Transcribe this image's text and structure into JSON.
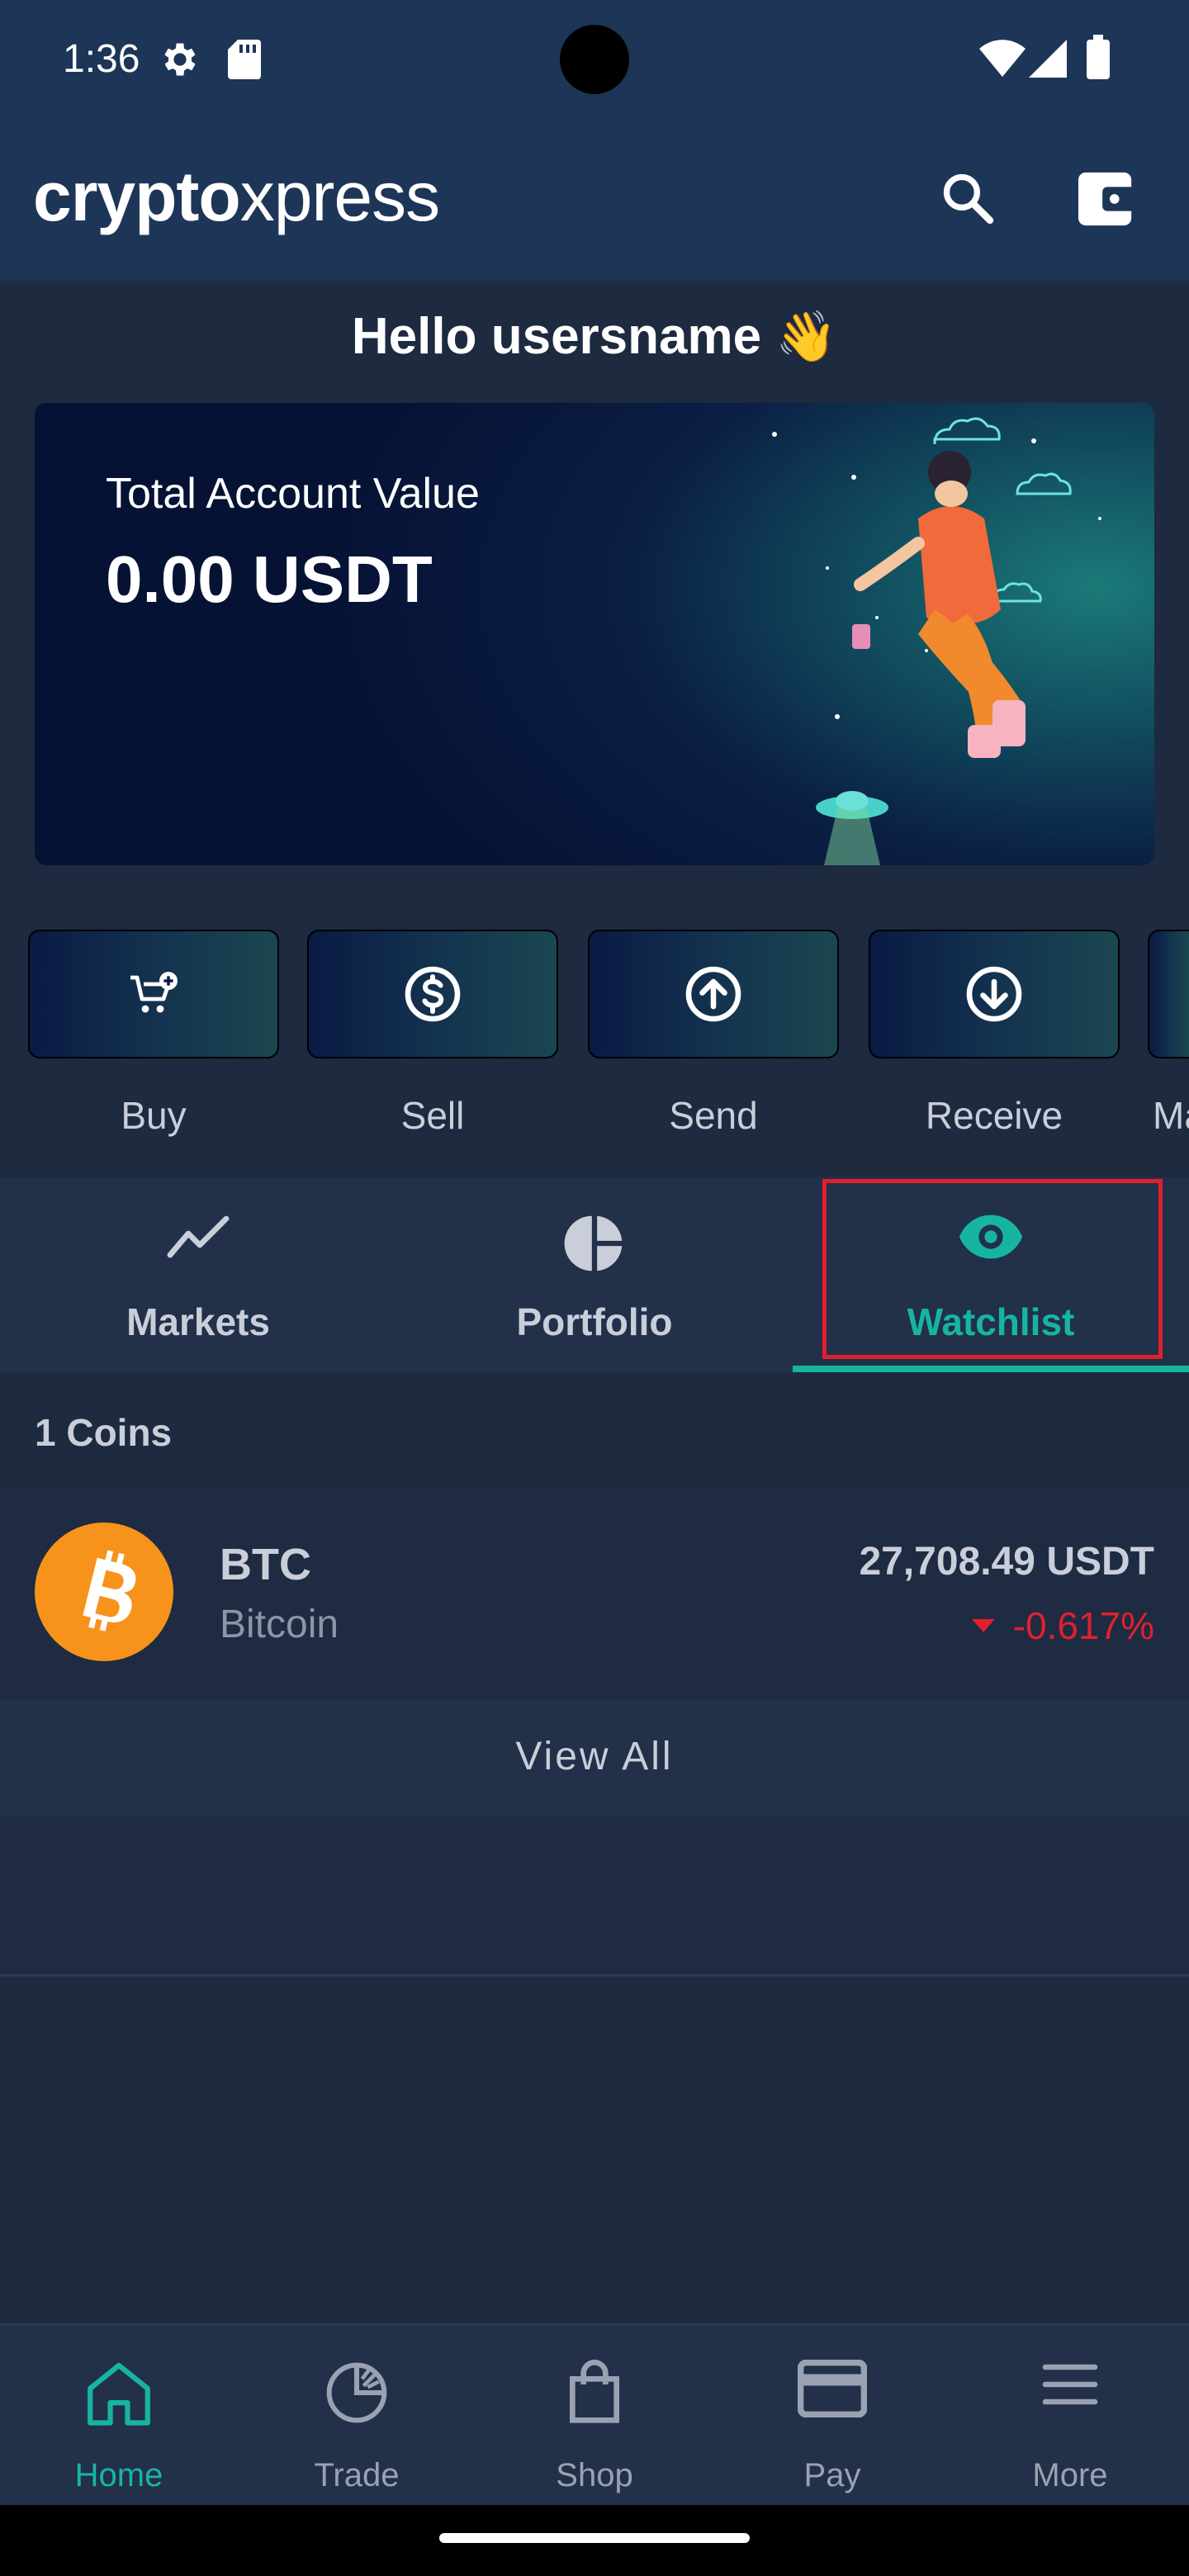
{
  "status_bar": {
    "time": "1:36"
  },
  "header": {
    "brand_bold": "crypto",
    "brand_light": "xpress"
  },
  "greeting": {
    "text": "Hello usersname",
    "emoji": "👋"
  },
  "account": {
    "label": "Total Account Value",
    "value": "0.00 USDT"
  },
  "actions": [
    {
      "label": "Buy",
      "icon": "cart-plus-icon"
    },
    {
      "label": "Sell",
      "icon": "dollar-circle-icon"
    },
    {
      "label": "Send",
      "icon": "arrow-up-circle-icon"
    },
    {
      "label": "Receive",
      "icon": "arrow-down-circle-icon"
    },
    {
      "label": "Ma",
      "icon": "partial-hidden"
    }
  ],
  "tabs": [
    {
      "label": "Markets",
      "icon": "trend-line-icon",
      "active": false
    },
    {
      "label": "Portfolio",
      "icon": "pie-chart-icon",
      "active": false
    },
    {
      "label": "Watchlist",
      "icon": "eye-icon",
      "active": true
    }
  ],
  "watchlist": {
    "count_label": "1 Coins",
    "coins": [
      {
        "symbol": "BTC",
        "name": "Bitcoin",
        "price": "27,708.49 USDT",
        "change": "-0.617%",
        "direction": "down"
      }
    ],
    "view_all": "View All"
  },
  "bottom_nav": [
    {
      "label": "Home",
      "icon": "home-icon",
      "active": true
    },
    {
      "label": "Trade",
      "icon": "trade-chart-icon",
      "active": false
    },
    {
      "label": "Shop",
      "icon": "shopping-bag-icon",
      "active": false
    },
    {
      "label": "Pay",
      "icon": "card-icon",
      "active": false
    },
    {
      "label": "More",
      "icon": "menu-icon",
      "active": false
    }
  ],
  "colors": {
    "accent": "#17b5a0",
    "negative": "#e0202e",
    "header_bg": "#1d3557",
    "page_bg": "#1d2a40",
    "btc": "#f7931a"
  }
}
